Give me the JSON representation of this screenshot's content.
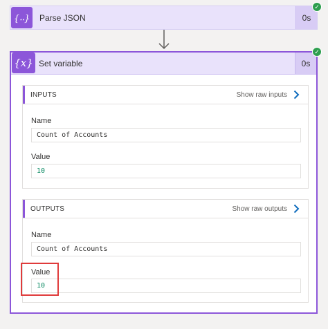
{
  "parse_json_step": {
    "icon": "{⸳⸳}",
    "title": "Parse JSON",
    "duration": "0s",
    "status": "succeeded"
  },
  "set_variable_step": {
    "icon": "{x}",
    "title": "Set variable",
    "duration": "0s",
    "status": "succeeded",
    "inputs": {
      "title": "INPUTS",
      "raw_link": "Show raw inputs",
      "name_label": "Name",
      "name_value": "Count of Accounts",
      "value_label": "Value",
      "value_value": "10"
    },
    "outputs": {
      "title": "OUTPUTS",
      "raw_link": "Show raw outputs",
      "name_label": "Name",
      "name_value": "Count of Accounts",
      "value_label": "Value",
      "value_value": "10"
    }
  },
  "colors": {
    "accent": "#8c56d9",
    "header_bg": "#e9e2fb",
    "success": "#2e9e4f",
    "highlight": "#e03b3b",
    "number": "#0b8a63"
  }
}
